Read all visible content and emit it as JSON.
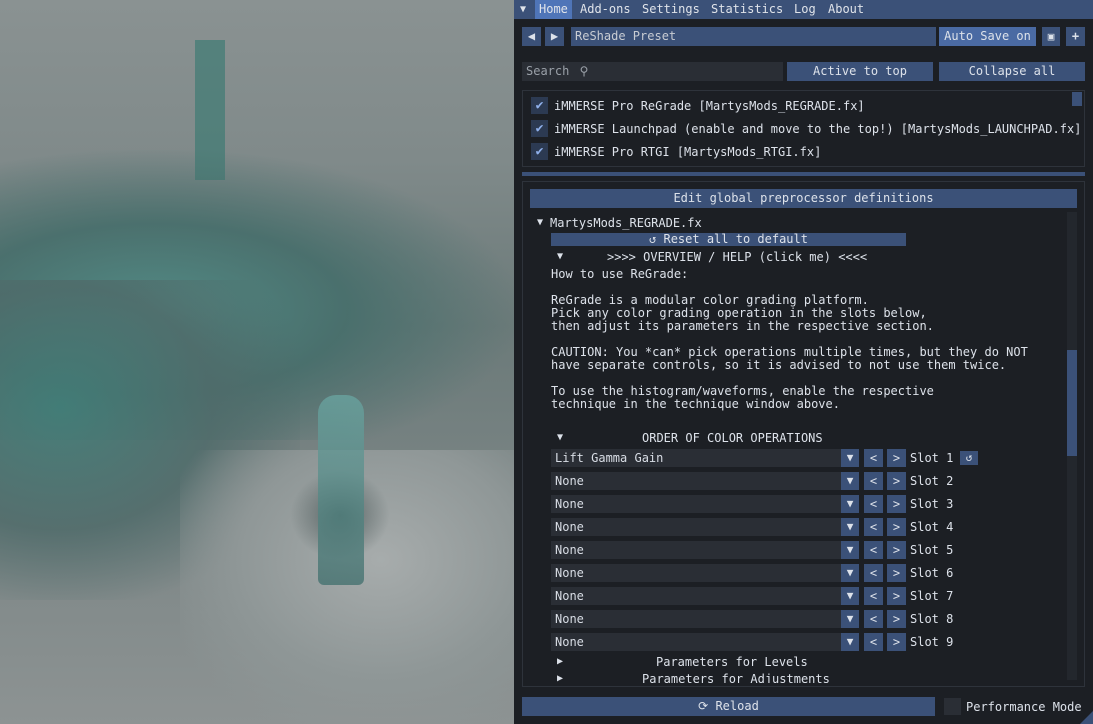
{
  "menu": {
    "items": [
      "Home",
      "Add-ons",
      "Settings",
      "Statistics",
      "Log",
      "About"
    ],
    "active": "Home"
  },
  "preset": {
    "prev_icon": "triangle-left-icon",
    "next_icon": "triangle-right-icon",
    "name": "ReShade Preset",
    "auto_save_label": "Auto Save on"
  },
  "search": {
    "placeholder": "Search"
  },
  "toolbar": {
    "active_to_top": "Active to top",
    "collapse_all": "Collapse all"
  },
  "techniques": [
    {
      "label": "iMMERSE Pro ReGrade [MartysMods_REGRADE.fx]",
      "checked": true
    },
    {
      "label": "iMMERSE Launchpad (enable and move to the top!) [MartysMods_LAUNCHPAD.fx]",
      "checked": true
    },
    {
      "label": "iMMERSE Pro RTGI [MartysMods_RTGI.fx]",
      "checked": true
    }
  ],
  "global_defs_label": "Edit global preprocessor definitions",
  "effect": {
    "file": "MartysMods_REGRADE.fx",
    "reset_label": "Reset all to default",
    "help_header": ">>>> OVERVIEW / HELP (click me) <<<<",
    "help_lines": [
      "How to use ReGrade:",
      "",
      "ReGrade is a modular color grading platform.",
      "Pick any color grading operation in the slots below,",
      "then adjust its parameters in the respective section.",
      "",
      "CAUTION: You *can* pick operations multiple times, but they do NOT",
      "have separate controls, so it is advised to not use them twice.",
      "",
      "To use the histogram/waveforms, enable the respective",
      "technique in the technique window above."
    ],
    "order_header": "ORDER OF COLOR OPERATIONS",
    "slots": [
      {
        "value": "Lift Gamma Gain",
        "label": "Slot 1"
      },
      {
        "value": "None",
        "label": "Slot 2"
      },
      {
        "value": "None",
        "label": "Slot 3"
      },
      {
        "value": "None",
        "label": "Slot 4"
      },
      {
        "value": "None",
        "label": "Slot 5"
      },
      {
        "value": "None",
        "label": "Slot 6"
      },
      {
        "value": "None",
        "label": "Slot 7"
      },
      {
        "value": "None",
        "label": "Slot 8"
      },
      {
        "value": "None",
        "label": "Slot 9"
      }
    ],
    "param_sections": [
      "Parameters for Levels",
      "Parameters for Adjustments"
    ]
  },
  "footer": {
    "reload_label": "Reload",
    "performance_mode_label": "Performance Mode"
  },
  "colors": {
    "accent": "#3b5178",
    "panel": "#1c1f24",
    "field": "#2a2e35"
  }
}
